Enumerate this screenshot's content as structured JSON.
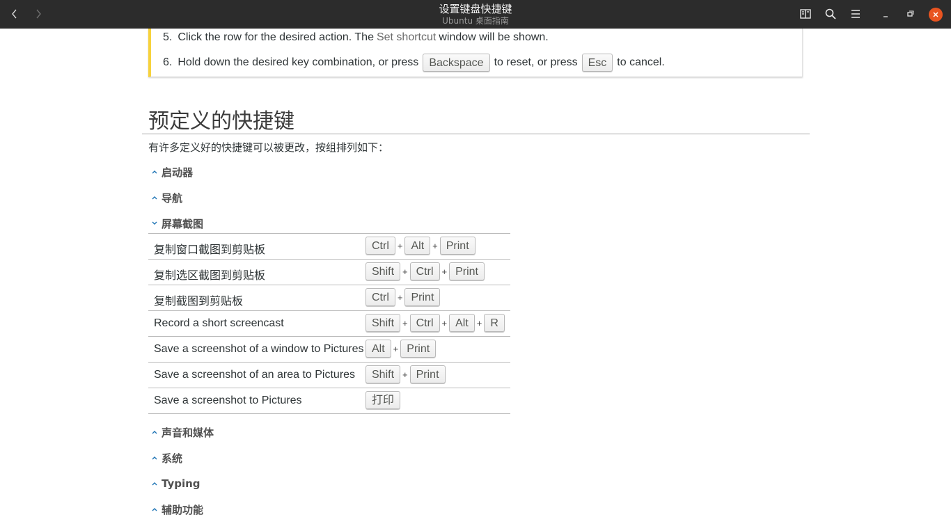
{
  "window": {
    "title": "设置键盘快捷键",
    "subtitle": "Ubuntu 桌面指南",
    "nav": [
      "back-icon",
      "forward-icon"
    ],
    "actions": [
      "bookmarks-icon",
      "search-icon",
      "menu-icon",
      "minimize-icon",
      "maximize-icon",
      "close-icon"
    ],
    "accent": "#e95420"
  },
  "steps": [
    {
      "num": "5.",
      "text_before": "Click the row for the desired action. The",
      "link": "Set shortcut",
      "text_after": "window will be shown."
    },
    {
      "num": "6.",
      "text_before": "Hold down the desired key combination, or press",
      "key1": "Backspace",
      "text_mid": "to reset, or press",
      "key2": "Esc",
      "text_after": "to cancel."
    }
  ],
  "note_color": "#f7d23c",
  "heading": "预定义的快捷键",
  "intro": "有许多定义好的快捷键可以被更改，按组排列如下：",
  "sections_above": [
    "启动器",
    "导航",
    "屏幕截图"
  ],
  "expanded_section": "屏幕截图",
  "plus": "+",
  "shortcuts": [
    {
      "label": "复制窗口截图到剪贴板",
      "keys": [
        "Ctrl",
        "Alt",
        "Print"
      ]
    },
    {
      "label": "复制选区截图到剪贴板",
      "keys": [
        "Shift",
        "Ctrl",
        "Print"
      ]
    },
    {
      "label": "复制截图到剪贴板",
      "keys": [
        "Ctrl",
        "Print"
      ]
    },
    {
      "label": "Record a short screencast",
      "keys": [
        "Shift",
        "Ctrl",
        "Alt",
        "R"
      ]
    },
    {
      "label": "Save a screenshot of a window to Pictures",
      "keys": [
        "Alt",
        "Print"
      ]
    },
    {
      "label": "Save a screenshot of an area to Pictures",
      "keys": [
        "Shift",
        "Print"
      ]
    },
    {
      "label": "Save a screenshot to Pictures",
      "keys": [
        "打印"
      ]
    }
  ],
  "sections_below": [
    "声音和媒体",
    "系统",
    "Typing",
    "辅助功能"
  ]
}
